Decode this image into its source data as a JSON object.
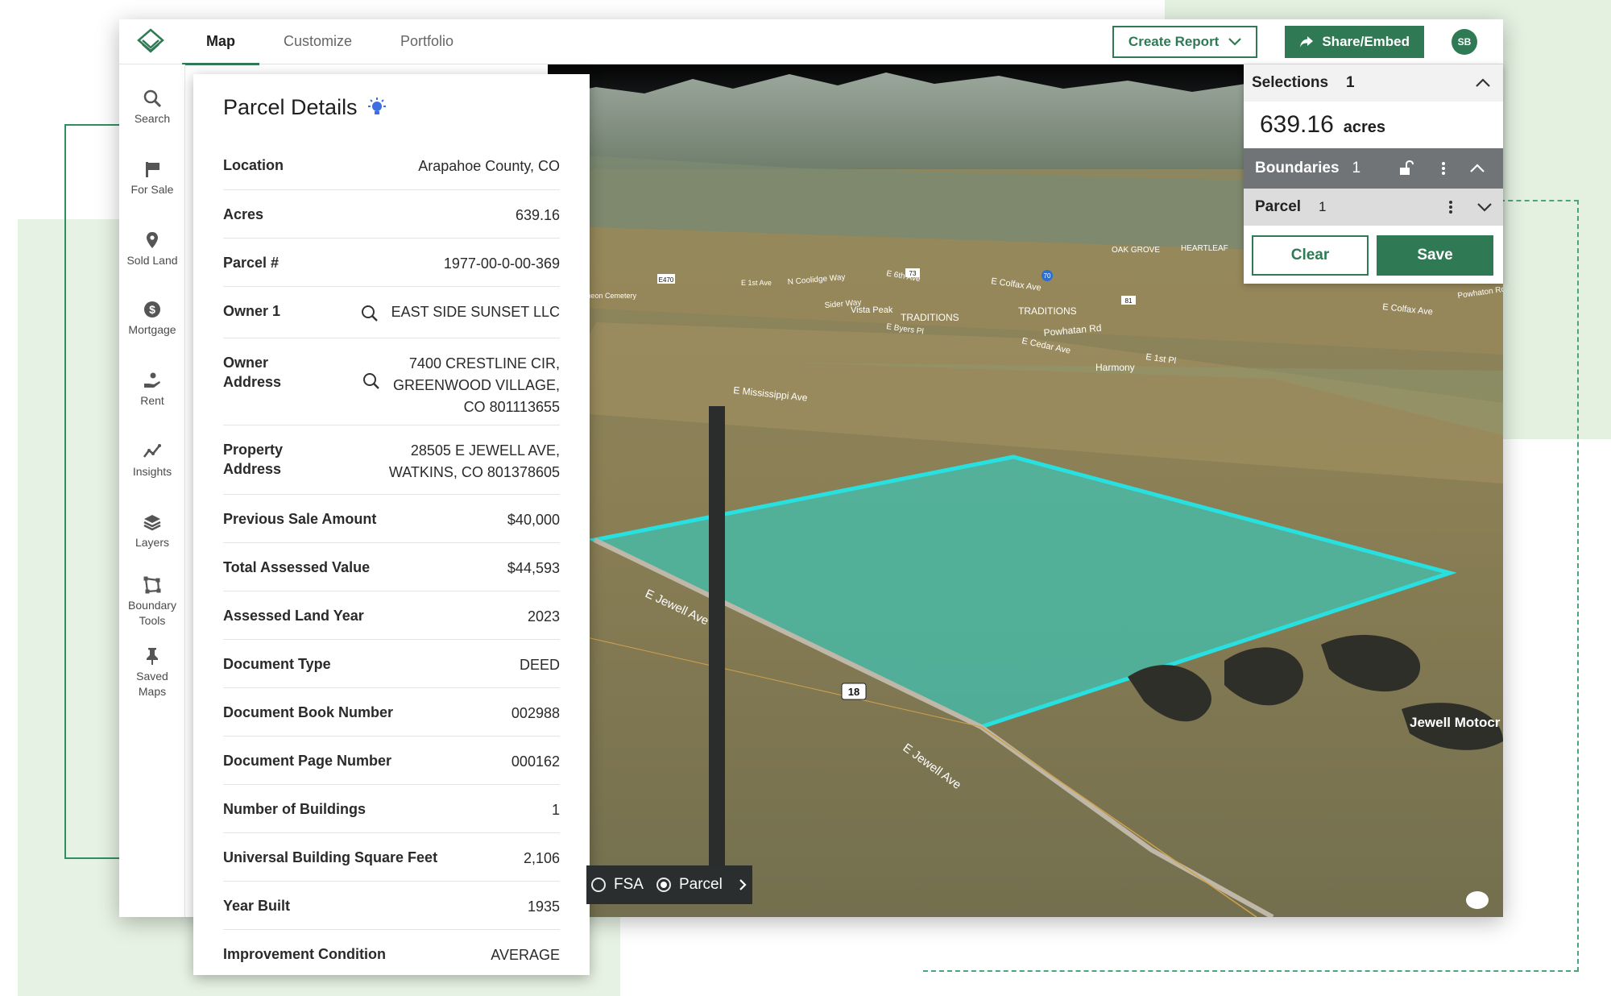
{
  "topbar": {
    "tabs": [
      "Map",
      "Customize",
      "Portfolio"
    ],
    "create_report": "Create Report",
    "share_embed": "Share/Embed",
    "avatar_initials": "SB",
    "accent": "#2f7a55"
  },
  "sidebar": {
    "items": [
      {
        "label": "Search",
        "icon": "search-icon"
      },
      {
        "label": "For Sale",
        "icon": "flag-icon"
      },
      {
        "label": "Sold Land",
        "icon": "pin-icon"
      },
      {
        "label": "Mortgage",
        "icon": "dollar-icon"
      },
      {
        "label": "Rent",
        "icon": "hand-coin-icon"
      },
      {
        "label": "Insights",
        "icon": "trend-icon"
      },
      {
        "label": "Layers",
        "icon": "layers-icon"
      },
      {
        "label": "Boundary Tools",
        "icon": "boundary-icon"
      },
      {
        "label": "Saved Maps",
        "icon": "pushpin-icon"
      }
    ]
  },
  "details": {
    "title": "Parcel Details",
    "rows": [
      {
        "key": "Location",
        "value": "Arapahoe County, CO"
      },
      {
        "key": "Acres",
        "value": "639.16"
      },
      {
        "key": "Parcel #",
        "value": "1977-00-0-00-369"
      },
      {
        "key": "Owner 1",
        "value": "EAST SIDE SUNSET LLC"
      },
      {
        "key": "Owner Address",
        "value": "7400 CRESTLINE CIR, GREENWOOD VILLAGE, CO 801113655"
      },
      {
        "key": "Property Address",
        "value": "28505 E JEWELL AVE, WATKINS, CO 801378605"
      },
      {
        "key": "Previous Sale Amount",
        "value": "$40,000"
      },
      {
        "key": "Total Assessed Value",
        "value": "$44,593"
      },
      {
        "key": "Assessed Land Year",
        "value": "2023"
      },
      {
        "key": "Document Type",
        "value": "DEED"
      },
      {
        "key": "Document Book Number",
        "value": "002988"
      },
      {
        "key": "Document Page Number",
        "value": "000162"
      },
      {
        "key": "Number of Buildings",
        "value": "1"
      },
      {
        "key": "Universal Building Square Feet",
        "value": "2,106"
      },
      {
        "key": "Year Built",
        "value": "1935"
      },
      {
        "key": "Improvement Condition",
        "value": "AVERAGE"
      }
    ],
    "owner_address_lines": [
      "7400 CRESTLINE CIR,",
      "GREENWOOD VILLAGE,",
      "CO 801113655"
    ],
    "property_address_lines": [
      "28505 E JEWELL AVE,",
      "WATKINS, CO 801378605"
    ],
    "key_owner_address_lines": [
      "Owner",
      "Address"
    ],
    "key_property_address_lines": [
      "Property",
      "Address"
    ]
  },
  "selections": {
    "title": "Selections",
    "count": "1",
    "acres": "639.16",
    "acres_unit": "acres",
    "boundaries_label": "Boundaries",
    "boundaries_count": "1",
    "parcel_label": "Parcel",
    "parcel_count": "1",
    "clear": "Clear",
    "save": "Save"
  },
  "map": {
    "layers": [
      "FSA",
      "Parcel"
    ],
    "selected_layer": "Parcel",
    "labels": {
      "e_jewell_1": "E Jewell Ave",
      "e_jewell_2": "E Jewell Ave",
      "hwy": "18",
      "mississippi": "E Mississippi Ave",
      "harmony": "Harmony",
      "powhatan": "Powhatan Rd",
      "traditions_1": "TRADITIONS",
      "traditions_2": "TRADITIONS",
      "vista_peak": "Vista Peak",
      "colfax_1": "E Colfax Ave",
      "colfax_2": "E Colfax Ave",
      "oak_grove": "OAK GROVE",
      "heartleaf": "HEARTLEAF",
      "cedar": "E Cedar Ave",
      "first": "E 1st Pl",
      "byers": "E Byers Pl",
      "elliff": "E 6th Ave",
      "coolidge": "N Coolidge Way",
      "sider": "Sider Way",
      "powhaton2": "Powhaton Rd",
      "e470": "E470",
      "i70": "70",
      "r81": "81",
      "r73": "73",
      "jewell_moto": "Jewell Motocr",
      "cemetery": "imeon Cemetery",
      "first_ave": "E 1st Ave"
    },
    "parcel_outline": "#29e0e0",
    "parcel_fill": "#3ec3b3"
  }
}
